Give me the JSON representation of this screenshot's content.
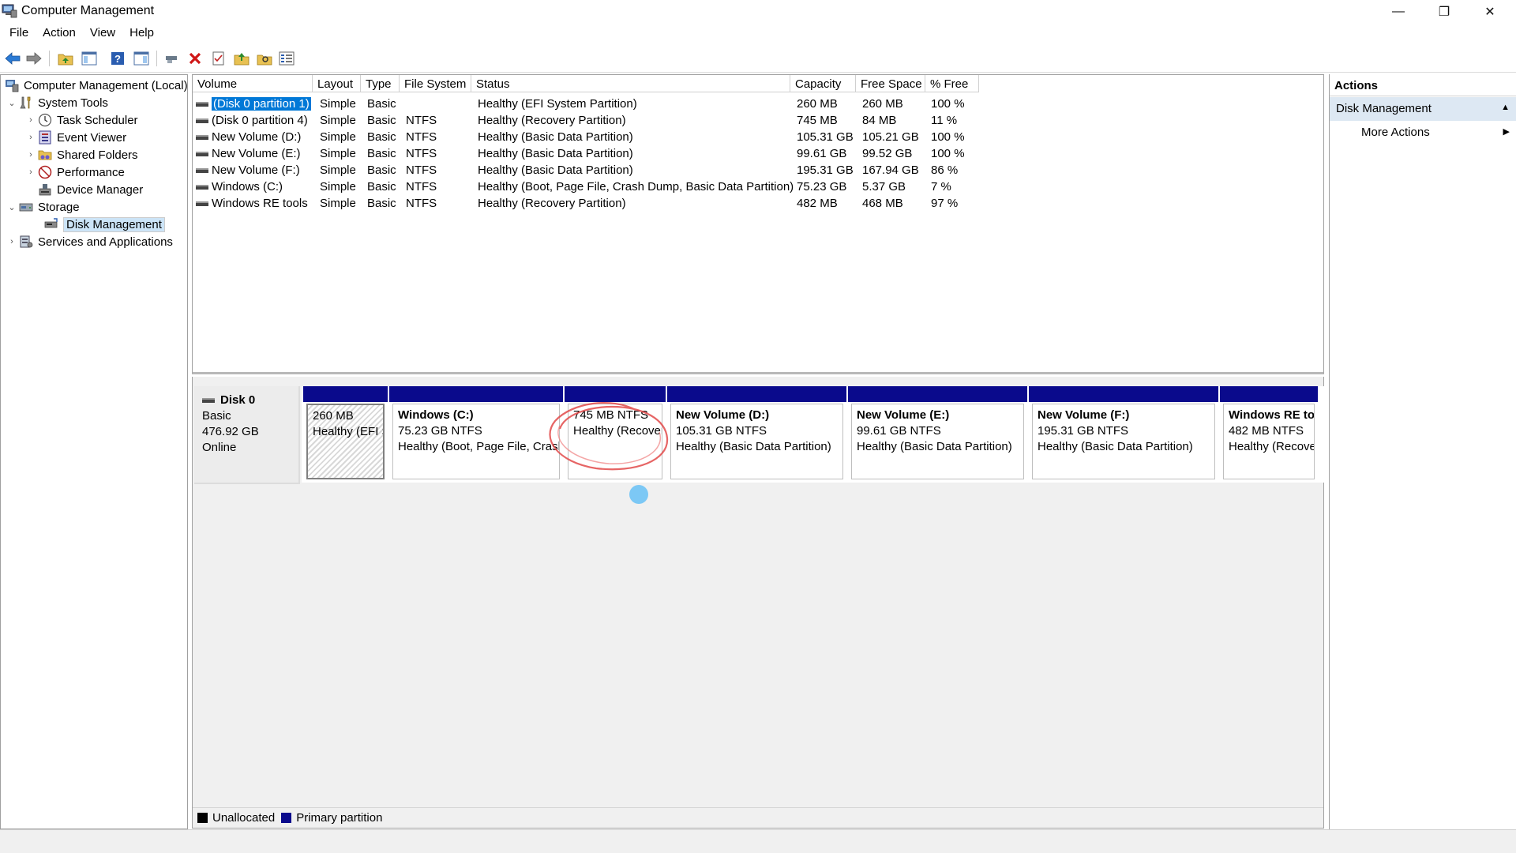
{
  "window": {
    "title": "Computer Management",
    "minimize_glyph": "—",
    "maximize_glyph": "❐",
    "close_glyph": "✕"
  },
  "menu": [
    "File",
    "Action",
    "View",
    "Help"
  ],
  "toolbar_icons": [
    "back-arrow-icon",
    "forward-arrow-icon",
    "up-folder-icon",
    "show-hide-tree-icon",
    "help-icon",
    "show-hide-action-pane-icon",
    "connect-icon",
    "delete-icon",
    "properties-icon",
    "import-icon",
    "find-icon",
    "list-view-icon"
  ],
  "tree": {
    "root": "Computer Management (Local)",
    "system_tools": "System Tools",
    "task_scheduler": "Task Scheduler",
    "event_viewer": "Event Viewer",
    "shared_folders": "Shared Folders",
    "performance": "Performance",
    "device_manager": "Device Manager",
    "storage": "Storage",
    "disk_management": "Disk Management",
    "services": "Services and Applications"
  },
  "volume_table": {
    "columns": [
      "Volume",
      "Layout",
      "Type",
      "File System",
      "Status",
      "Capacity",
      "Free Space",
      "% Free"
    ],
    "rows": [
      {
        "volume": "(Disk 0 partition 1)",
        "layout": "Simple",
        "type": "Basic",
        "fs": "",
        "status": "Healthy (EFI System Partition)",
        "capacity": "260 MB",
        "free": "260 MB",
        "pct": "100 %"
      },
      {
        "volume": "(Disk 0 partition 4)",
        "layout": "Simple",
        "type": "Basic",
        "fs": "NTFS",
        "status": "Healthy (Recovery Partition)",
        "capacity": "745 MB",
        "free": "84 MB",
        "pct": "11 %"
      },
      {
        "volume": "New Volume (D:)",
        "layout": "Simple",
        "type": "Basic",
        "fs": "NTFS",
        "status": "Healthy (Basic Data Partition)",
        "capacity": "105.31 GB",
        "free": "105.21 GB",
        "pct": "100 %"
      },
      {
        "volume": "New Volume (E:)",
        "layout": "Simple",
        "type": "Basic",
        "fs": "NTFS",
        "status": "Healthy (Basic Data Partition)",
        "capacity": "99.61 GB",
        "free": "99.52 GB",
        "pct": "100 %"
      },
      {
        "volume": "New Volume (F:)",
        "layout": "Simple",
        "type": "Basic",
        "fs": "NTFS",
        "status": "Healthy (Basic Data Partition)",
        "capacity": "195.31 GB",
        "free": "167.94 GB",
        "pct": "86 %"
      },
      {
        "volume": "Windows (C:)",
        "layout": "Simple",
        "type": "Basic",
        "fs": "NTFS",
        "status": "Healthy (Boot, Page File, Crash Dump, Basic Data Partition)",
        "capacity": "75.23 GB",
        "free": "5.37 GB",
        "pct": "7 %"
      },
      {
        "volume": "Windows RE tools",
        "layout": "Simple",
        "type": "Basic",
        "fs": "NTFS",
        "status": "Healthy (Recovery Partition)",
        "capacity": "482 MB",
        "free": "468 MB",
        "pct": "97 %"
      }
    ]
  },
  "disk": {
    "name": "Disk 0",
    "type": "Basic",
    "size": "476.92 GB",
    "state": "Online"
  },
  "partitions": [
    {
      "name": "",
      "size": "260 MB",
      "status": "Healthy (EFI S"
    },
    {
      "name": "Windows  (C:)",
      "size": "75.23 GB NTFS",
      "status": "Healthy (Boot, Page File, Crash"
    },
    {
      "name": "",
      "size": "745 MB NTFS",
      "status": "Healthy (Recover"
    },
    {
      "name": "New Volume  (D:)",
      "size": "105.31 GB NTFS",
      "status": "Healthy (Basic Data Partition)"
    },
    {
      "name": "New Volume  (E:)",
      "size": "99.61 GB NTFS",
      "status": "Healthy (Basic Data Partition)"
    },
    {
      "name": "New Volume  (F:)",
      "size": "195.31 GB NTFS",
      "status": "Healthy (Basic Data Partition)"
    },
    {
      "name": "Windows RE to",
      "size": "482 MB NTFS",
      "status": "Healthy (Recove"
    }
  ],
  "legend": {
    "unallocated": "Unallocated",
    "unallocated_color": "#000000",
    "primary": "Primary partition",
    "primary_color": "#0a0a8c"
  },
  "actions": {
    "header": "Actions",
    "section": "Disk Management",
    "more": "More Actions"
  },
  "colors": {
    "selection": "#0078d7",
    "partition_bar": "#0a0a8c",
    "action_section": "#dde8f3"
  }
}
